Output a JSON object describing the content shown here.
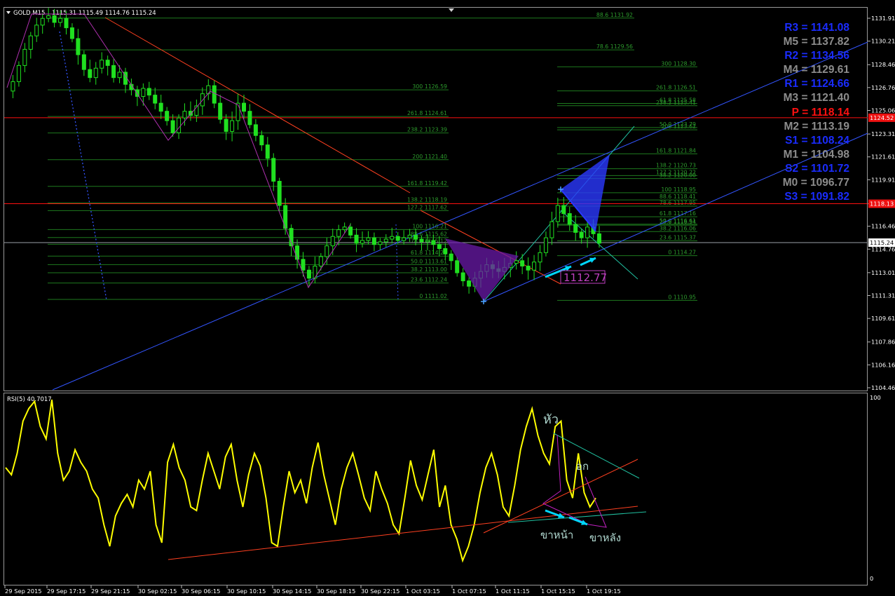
{
  "window": {
    "symbol_header": "GOLD,M15",
    "ohlc_header": "1115.31 1115.49 1114.76 1115.24",
    "price_axis": [
      "1131.91",
      "1130.21",
      "1128.46",
      "1126.76",
      "1125.06",
      "1123.31",
      "1121.61",
      "1119.91",
      "1118.13",
      "1116.46",
      "1114.76",
      "1113.01",
      "1111.31",
      "1109.61",
      "1107.86",
      "1106.16",
      "1104.46"
    ],
    "current_price_tag": "1115.24",
    "red_level_tags": [
      "1124.52",
      "1118.13"
    ],
    "rsi_label": "RSI(5) 40.7017",
    "rsi_axis": [
      "100",
      "0"
    ],
    "time_axis": [
      "29 Sep 2015",
      "29 Sep 17:15",
      "29 Sep 21:15",
      "30 Sep 02:15",
      "30 Sep 06:15",
      "30 Sep 10:15",
      "30 Sep 14:15",
      "30 Sep 18:15",
      "30 Sep 22:15",
      "1 Oct 03:15",
      "1 Oct 07:15",
      "1 Oct 11:15",
      "1 Oct 15:15",
      "1 Oct 19:15"
    ]
  },
  "pivots": [
    {
      "name": "R3",
      "value": "1141.08",
      "color": "#1a2cff"
    },
    {
      "name": "M5",
      "value": "1137.82",
      "color": "#8c8c8c"
    },
    {
      "name": "R2",
      "value": "1134.56",
      "color": "#1a2cff"
    },
    {
      "name": "M4",
      "value": "1129.61",
      "color": "#8c8c8c"
    },
    {
      "name": "R1",
      "value": "1124.66",
      "color": "#1a2cff"
    },
    {
      "name": "M3",
      "value": "1121.40",
      "color": "#8c8c8c"
    },
    {
      "name": "P ",
      "value": "1118.14",
      "color": "#ff1010"
    },
    {
      "name": "M2",
      "value": "1113.19",
      "color": "#8c8c8c"
    },
    {
      "name": "S1",
      "value": "1108.24",
      "color": "#1a2cff"
    },
    {
      "name": "M1",
      "value": "1104.98",
      "color": "#8c8c8c"
    },
    {
      "name": "S2",
      "value": "1101.72",
      "color": "#1a2cff"
    },
    {
      "name": "M0",
      "value": "1096.77",
      "color": "#8c8c8c"
    },
    {
      "name": "S3",
      "value": "1091.82",
      "color": "#1a2cff"
    }
  ],
  "fib_groups": [
    [
      "88.6 1131.92",
      "78.6 1129.56"
    ],
    [
      "300 1126.59",
      "261.8 1124.61",
      "238.2 1123.39",
      "200 1121.40",
      "161.8 1119.42",
      "138.2 1118.19",
      "127.2 1117.62",
      "100 1116.21",
      "88.6 1115.62",
      "78.6 1115.12",
      "61.8 1114.24",
      "50.0 1113.61",
      "38.2 1113.00",
      "23.6 1112.24",
      "0 1111.02"
    ],
    [
      "300 1128.30",
      "261.8 1126.51",
      "238.2 1125.41",
      "200 1123.62",
      "161.8 1121.84",
      "138.2 1120.73",
      "127.2 1120.22",
      "100 1118.95",
      "88.6 1118.41",
      "78.6 1117.95",
      "61.8 1117.16",
      "50.0 1116.61",
      "38.2 1116.06",
      "23.6 1115.37",
      "0 1114.27"
    ],
    [
      "61.8 1125.58",
      "50.0 1123.79",
      "38.2 1120.00",
      "23.6 1116.54",
      "0 1110.95"
    ]
  ],
  "annotations": {
    "price_box": "1112.77",
    "rsi_head": "หัว",
    "rsi_shoulder": "อก",
    "rsi_front_leg": "ขาหน้า",
    "rsi_back_leg": "ขาหลัง"
  },
  "colors": {
    "candle_up": "#20e020",
    "candle_down": "#20e020",
    "rsi_line": "#ffff00",
    "grid_fib": "#1e7a1e",
    "fib_text": "#2d9b2d",
    "trend_blue": "#3355ff",
    "trend_red": "#ff4020",
    "pattern_purple": "#6a1aa8",
    "annot_cyan": "#00d8ff",
    "pivot_red_line": "#ff1010"
  },
  "chart_data": {
    "type": "candlestick",
    "symbol": "GOLD",
    "timeframe": "M15",
    "ylim": [
      1104.46,
      1132.2
    ],
    "close_path": [
      1126.5,
      1127.2,
      1128.4,
      1129.6,
      1130.6,
      1131.4,
      1131.9,
      1132.1,
      1131.6,
      1131.9,
      1131.2,
      1130.4,
      1129.2,
      1128.1,
      1127.5,
      1128.2,
      1128.8,
      1128.4,
      1127.5,
      1127.9,
      1127.0,
      1126.6,
      1126.1,
      1126.7,
      1126.2,
      1125.6,
      1125.0,
      1124.3,
      1123.4,
      1124.5,
      1125.0,
      1124.7,
      1125.4,
      1126.3,
      1126.9,
      1125.6,
      1124.4,
      1123.5,
      1124.3,
      1125.6,
      1125.0,
      1124.0,
      1123.2,
      1122.5,
      1121.5,
      1119.8,
      1118.0,
      1116.3,
      1115.0,
      1114.0,
      1113.2,
      1112.6,
      1113.5,
      1114.2,
      1115.0,
      1115.7,
      1116.2,
      1116.4,
      1115.8,
      1115.2,
      1115.4,
      1115.6,
      1115.1,
      1115.3,
      1115.5,
      1115.7,
      1115.4,
      1115.6,
      1115.8,
      1115.5,
      1115.3,
      1115.4,
      1115.1,
      1114.8,
      1114.4,
      1113.9,
      1113.0,
      1112.4,
      1112.0,
      1112.6,
      1113.1,
      1113.6,
      1113.3,
      1113.1,
      1113.4,
      1113.7,
      1113.9,
      1113.5,
      1113.2,
      1113.8,
      1114.5,
      1115.6,
      1116.8,
      1118.0,
      1117.4,
      1116.6,
      1116.0,
      1115.6,
      1116.4,
      1115.9,
      1115.2
    ],
    "rsi_ylim": [
      0,
      100
    ],
    "rsi_values": [
      62,
      58,
      70,
      88,
      95,
      99,
      85,
      78,
      100,
      70,
      55,
      60,
      72,
      65,
      60,
      50,
      45,
      30,
      18,
      35,
      42,
      47,
      40,
      55,
      50,
      60,
      30,
      20,
      65,
      75,
      62,
      55,
      40,
      38,
      55,
      70,
      60,
      50,
      68,
      75,
      55,
      40,
      58,
      70,
      63,
      45,
      20,
      18,
      40,
      60,
      48,
      55,
      42,
      62,
      76,
      58,
      44,
      30,
      50,
      62,
      70,
      58,
      45,
      38,
      60,
      50,
      42,
      30,
      25,
      45,
      66,
      52,
      44,
      58,
      72,
      40,
      52,
      30,
      22,
      10,
      18,
      30,
      48,
      62,
      70,
      58,
      40,
      35,
      52,
      72,
      85,
      95,
      80,
      70,
      64,
      85,
      88,
      55,
      45,
      70,
      48,
      40,
      45
    ],
    "pivots": {
      "R3": 1141.08,
      "M5": 1137.82,
      "R2": 1134.56,
      "M4": 1129.61,
      "R1": 1124.66,
      "M3": 1121.4,
      "P": 1118.14,
      "M2": 1113.19,
      "S1": 1108.24,
      "M1": 1104.98,
      "S2": 1101.72,
      "M0": 1096.77,
      "S3": 1091.82
    }
  }
}
